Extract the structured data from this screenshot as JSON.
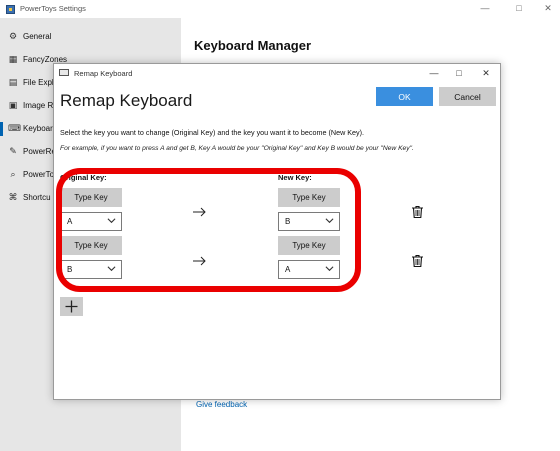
{
  "window": {
    "title": "PowerToys Settings",
    "controls": [
      "—",
      "□",
      "✕"
    ]
  },
  "sidebar": {
    "items": [
      {
        "label": "General",
        "icon": "gear-icon",
        "glyph": "⚙"
      },
      {
        "label": "FancyZones",
        "icon": "zones-icon",
        "glyph": "▦"
      },
      {
        "label": "File Explo",
        "icon": "folder-icon",
        "glyph": "▤"
      },
      {
        "label": "Image Re",
        "icon": "image-icon",
        "glyph": "▣"
      },
      {
        "label": "Keyboard",
        "icon": "keyboard-icon",
        "glyph": "⌨",
        "selected": true
      },
      {
        "label": "PowerRe",
        "icon": "rename-icon",
        "glyph": "✎"
      },
      {
        "label": "PowerToy",
        "icon": "run-icon",
        "glyph": "⌕"
      },
      {
        "label": "Shortcu",
        "icon": "shortcut-icon",
        "glyph": "⌘"
      }
    ]
  },
  "content": {
    "title": "Keyboard Manager",
    "feedback_link": "Give feedback"
  },
  "dialog": {
    "caption": "Remap Keyboard",
    "heading": "Remap Keyboard",
    "ok_label": "OK",
    "cancel_label": "Cancel",
    "instruction": "Select the key you want to change (Original Key) and the key you want it to become (New Key).",
    "example": "For example, if you want to press A and get B, Key A would be your \"Original Key\" and Key B would be your \"New Key\".",
    "original_header": "Original Key:",
    "new_header": "New Key:",
    "type_key_label": "Type Key",
    "rows": [
      {
        "original": "A",
        "new": "B"
      },
      {
        "original": "B",
        "new": "A"
      }
    ],
    "add_button_glyph": "+"
  },
  "colors": {
    "accent": "#3a8fdf",
    "highlight": "#ea0000",
    "sidebar_bg": "#e6e6e6",
    "link": "#0063b1"
  }
}
